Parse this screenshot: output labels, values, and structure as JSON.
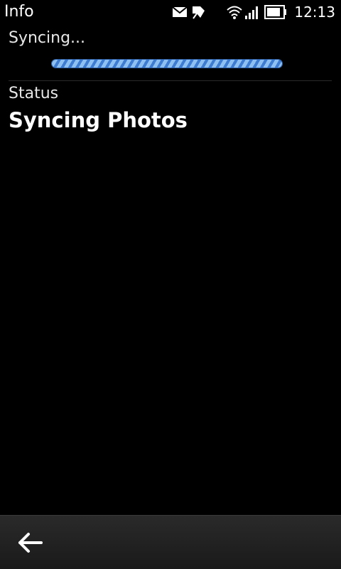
{
  "status_bar": {
    "app_title": "Info",
    "time": "12:13",
    "icons": [
      "mail-icon",
      "notification-icon",
      "wifi-icon",
      "signal-icon",
      "battery-icon"
    ]
  },
  "sync": {
    "label": "Syncing...",
    "progress_state": "indeterminate"
  },
  "status": {
    "heading": "Status",
    "value": "Syncing Photos"
  },
  "toolbar": {
    "back_icon": "back-arrow-icon"
  },
  "colors": {
    "background": "#000000",
    "text": "#ffffff",
    "progress_accent": "#3d7cd0",
    "toolbar": "#222222"
  }
}
